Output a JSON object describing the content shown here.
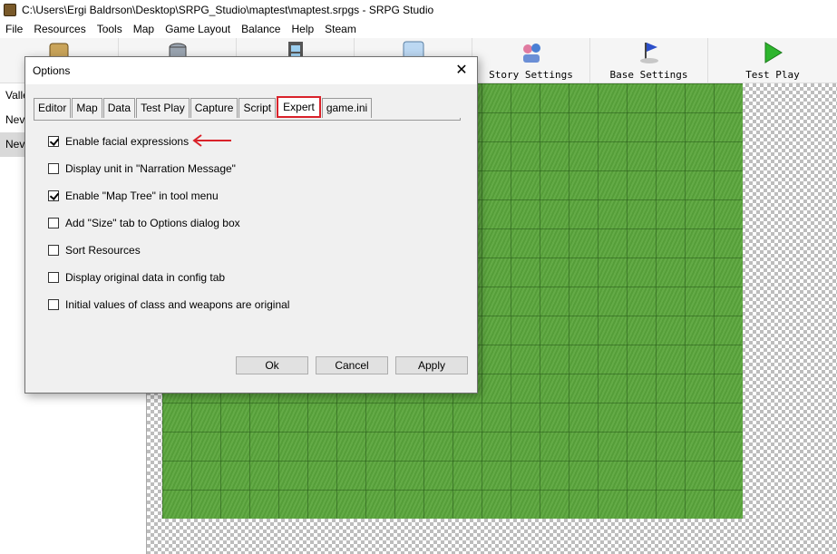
{
  "window": {
    "title": "C:\\Users\\Ergi Baldrson\\Desktop\\SRPG_Studio\\maptest\\maptest.srpgs - SRPG Studio"
  },
  "menu": [
    "File",
    "Resources",
    "Tools",
    "Map",
    "Game Layout",
    "Balance",
    "Help",
    "Steam"
  ],
  "toolbar": {
    "story_settings": "Story Settings",
    "base_settings": "Base Settings",
    "test_play": "Test Play"
  },
  "left_panel": {
    "items": [
      "Valle",
      "Nev",
      "Nev"
    ]
  },
  "dialog": {
    "title": "Options",
    "close_glyph": "✕",
    "tabs": [
      "Editor",
      "Map",
      "Data",
      "Test Play",
      "Capture",
      "Script",
      "Expert",
      "game.ini"
    ],
    "active_tab": "Expert",
    "options": [
      {
        "label": "Enable facial expressions",
        "checked": true
      },
      {
        "label": "Display unit in \"Narration Message\"",
        "checked": false
      },
      {
        "label": "Enable \"Map Tree\" in tool menu",
        "checked": true
      },
      {
        "label": "Add \"Size\" tab to Options dialog box",
        "checked": false
      },
      {
        "label": "Sort Resources",
        "checked": false
      },
      {
        "label": "Display original data in config tab",
        "checked": false
      },
      {
        "label": "Initial values of class and weapons are original",
        "checked": false
      }
    ],
    "buttons": {
      "ok": "Ok",
      "cancel": "Cancel",
      "apply": "Apply"
    }
  },
  "colors": {
    "highlight": "#d9222a",
    "grass": "#5aa63c"
  }
}
